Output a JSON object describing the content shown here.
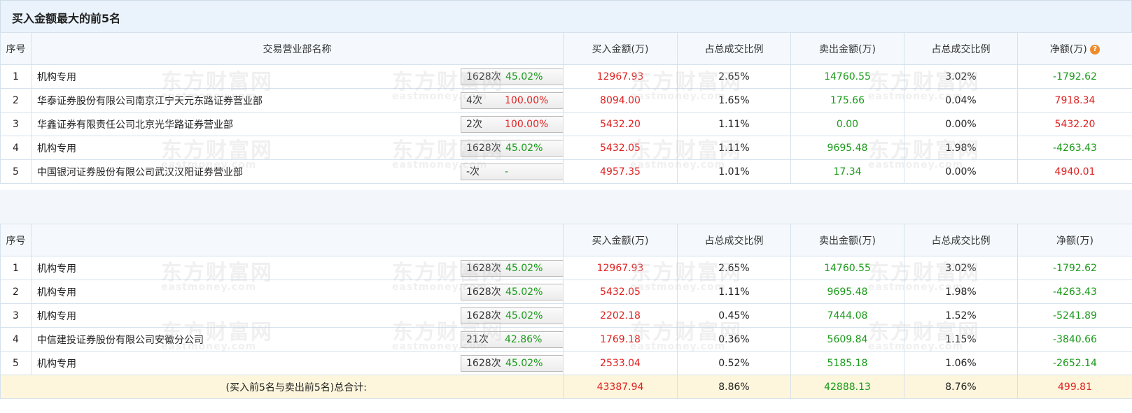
{
  "title": "买入金额最大的前5名",
  "header": {
    "index": "序号",
    "name": "交易营业部名称",
    "buy": "买入金额(万)",
    "buy_ratio": "占总成交比例",
    "sell": "卖出金额(万)",
    "sell_ratio": "占总成交比例",
    "net": "净额(万)"
  },
  "buy_rows": [
    {
      "index": "1",
      "name": "机构专用",
      "count": "1628次",
      "pct": "45.02%",
      "buy": "12967.93",
      "buy_ratio": "2.65%",
      "sell": "14760.55",
      "sell_ratio": "3.02%",
      "net": "-1792.62",
      "icon": "question-icon"
    },
    {
      "index": "2",
      "name": "华泰证券股份有限公司南京江宁天元东路证券营业部",
      "count": "4次",
      "pct": "100.00%",
      "buy": "8094.00",
      "buy_ratio": "1.65%",
      "sell": "175.66",
      "sell_ratio": "0.04%",
      "net": "7918.34",
      "icon": "arrow-right-icon"
    },
    {
      "index": "3",
      "name": "华鑫证券有限责任公司北京光华路证券营业部",
      "count": "2次",
      "pct": "100.00%",
      "buy": "5432.20",
      "buy_ratio": "1.11%",
      "sell": "0.00",
      "sell_ratio": "0.00%",
      "net": "5432.20",
      "icon": "arrow-right-icon"
    },
    {
      "index": "4",
      "name": "机构专用",
      "count": "1628次",
      "pct": "45.02%",
      "buy": "5432.05",
      "buy_ratio": "1.11%",
      "sell": "9695.48",
      "sell_ratio": "1.98%",
      "net": "-4263.43",
      "icon": "arrow-right-icon"
    },
    {
      "index": "5",
      "name": "中国银河证券股份有限公司武汉汉阳证券营业部",
      "count": "-次",
      "pct": "-",
      "buy": "4957.35",
      "buy_ratio": "1.01%",
      "sell": "17.34",
      "sell_ratio": "0.00%",
      "net": "4940.01",
      "icon": "arrow-right-icon"
    }
  ],
  "sell_header": {
    "index": "序号",
    "buy": "买入金额(万)",
    "buy_ratio": "占总成交比例",
    "sell": "卖出金额(万)",
    "sell_ratio": "占总成交比例",
    "net": "净额(万)"
  },
  "sell_rows": [
    {
      "index": "1",
      "name": "机构专用",
      "count": "1628次",
      "pct": "45.02%",
      "buy": "12967.93",
      "buy_ratio": "2.65%",
      "sell": "14760.55",
      "sell_ratio": "3.02%",
      "net": "-1792.62",
      "icon": "question-icon"
    },
    {
      "index": "2",
      "name": "机构专用",
      "count": "1628次",
      "pct": "45.02%",
      "buy": "5432.05",
      "buy_ratio": "1.11%",
      "sell": "9695.48",
      "sell_ratio": "1.98%",
      "net": "-4263.43",
      "icon": "arrow-right-icon"
    },
    {
      "index": "3",
      "name": "机构专用",
      "count": "1628次",
      "pct": "45.02%",
      "buy": "2202.18",
      "buy_ratio": "0.45%",
      "sell": "7444.08",
      "sell_ratio": "1.52%",
      "net": "-5241.89",
      "icon": "arrow-right-icon"
    },
    {
      "index": "4",
      "name": "中信建投证券股份有限公司安徽分公司",
      "count": "21次",
      "pct": "42.86%",
      "buy": "1769.18",
      "buy_ratio": "0.36%",
      "sell": "5609.84",
      "sell_ratio": "1.15%",
      "net": "-3840.66",
      "icon": "arrow-right-icon"
    },
    {
      "index": "5",
      "name": "机构专用",
      "count": "1628次",
      "pct": "45.02%",
      "buy": "2533.04",
      "buy_ratio": "0.52%",
      "sell": "5185.18",
      "sell_ratio": "1.06%",
      "net": "-2652.14",
      "icon": "arrow-right-icon"
    }
  ],
  "total": {
    "label": "(买入前5名与卖出前5名)总合计:",
    "buy": "43387.94",
    "buy_ratio": "8.86%",
    "sell": "42888.13",
    "sell_ratio": "8.76%",
    "net": "499.81"
  },
  "watermark": {
    "cn": "东方财富网",
    "en": "eastmoney.com"
  },
  "colors": {
    "positive": "#e02020",
    "negative": "#1a9a1a",
    "header_bg": "#f5f9fd",
    "total_bg": "#fdf6dc"
  }
}
